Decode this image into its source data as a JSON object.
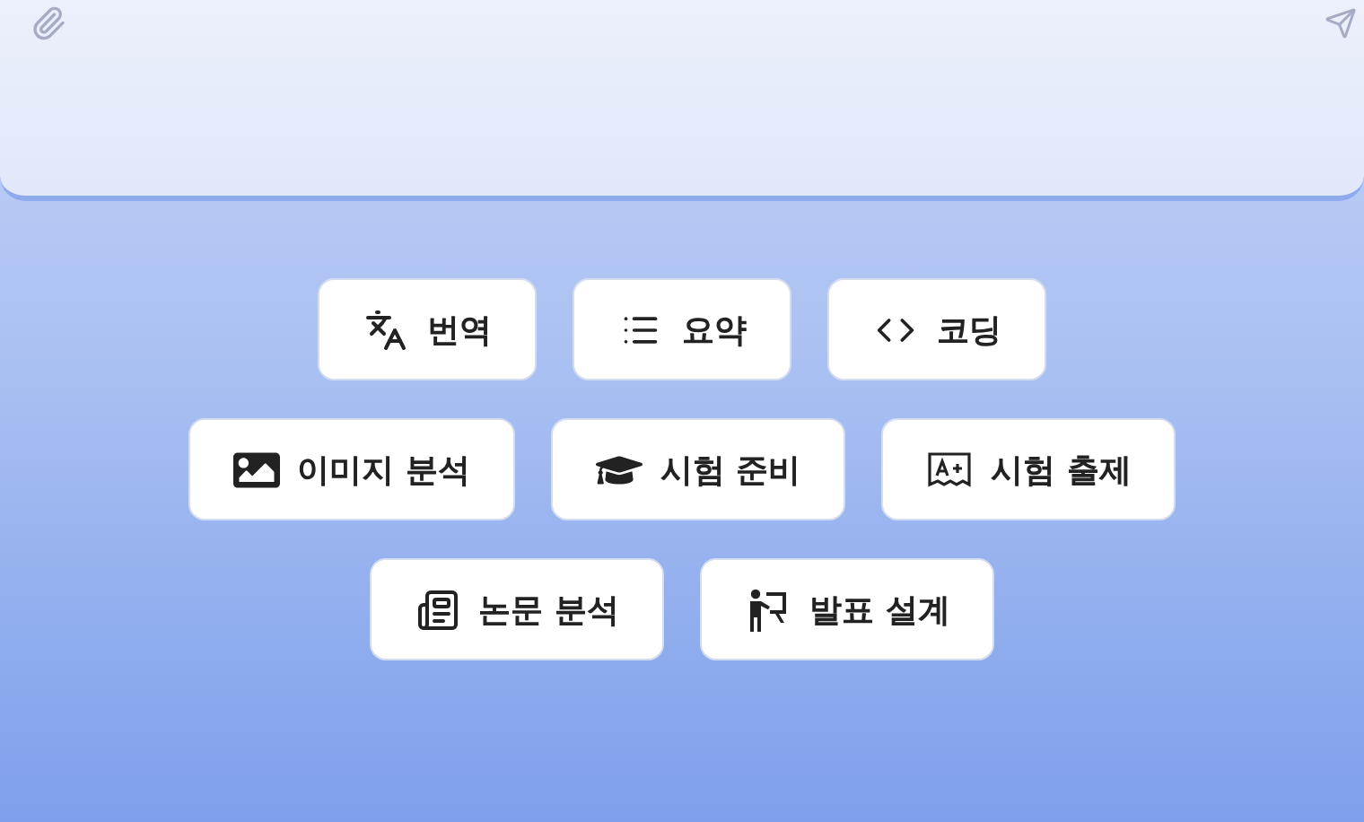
{
  "quick_actions": [
    [
      {
        "label": "번역",
        "kind": "translate"
      },
      {
        "label": "요약",
        "kind": "list"
      },
      {
        "label": "코딩",
        "kind": "code"
      }
    ],
    [
      {
        "label": "이미지 분석",
        "kind": "image"
      },
      {
        "label": "시험 준비",
        "kind": "graduation"
      },
      {
        "label": "시험 출제",
        "kind": "grade"
      }
    ],
    [
      {
        "label": "논문 분석",
        "kind": "newspaper"
      },
      {
        "label": "발표 설계",
        "kind": "presenter"
      }
    ]
  ]
}
